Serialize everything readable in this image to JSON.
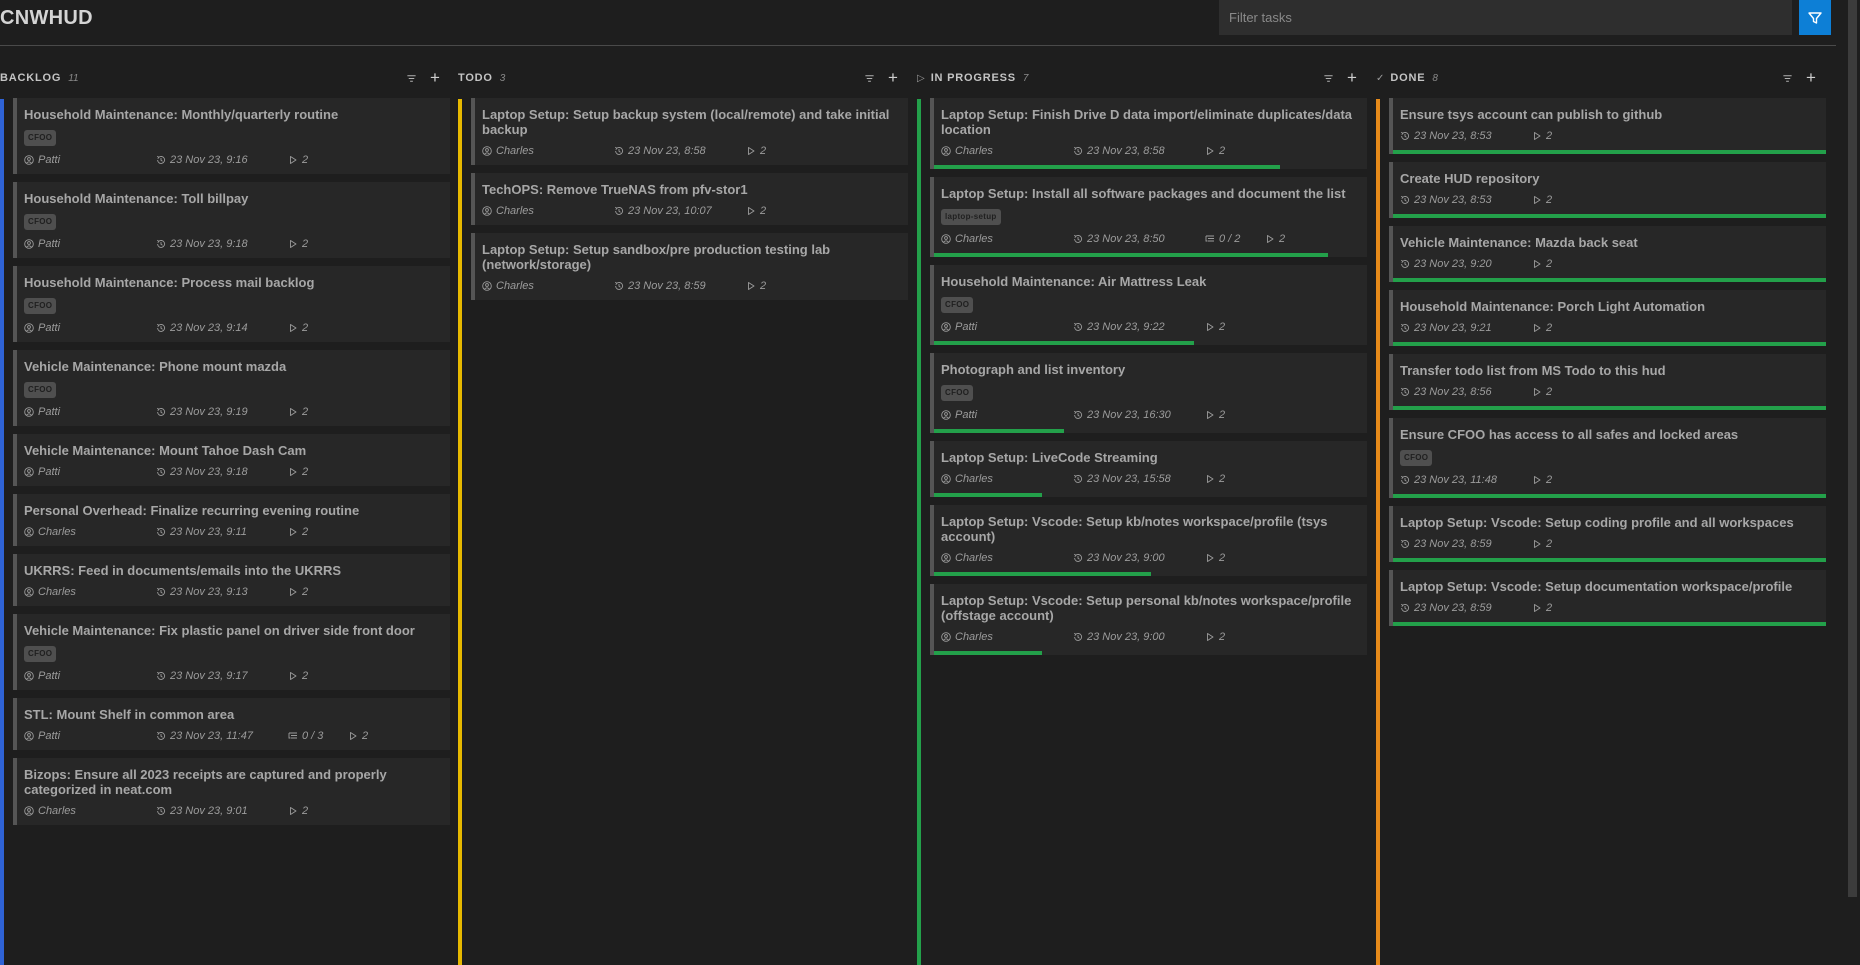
{
  "app": {
    "title": "CNWHUD"
  },
  "filter": {
    "placeholder": "Filter tasks",
    "button_icon": "filter-icon"
  },
  "colors": {
    "backlog": "#2f63d6",
    "todo": "#e6b800",
    "in_progress": "#23a04a",
    "done": "#e68a1a",
    "progress": "#23a04a",
    "accent": "#0d7fd6"
  },
  "columns": [
    {
      "name": "BACKLOG",
      "count": "11",
      "prefix": "",
      "cards": [
        {
          "title": "Household Maintenance: Monthly/quarterly routine",
          "tag": "CFOO",
          "owner": "Patti",
          "date": "23 Nov 23, 9:16",
          "points": "2"
        },
        {
          "title": "Household Maintenance: Toll billpay",
          "tag": "CFOO",
          "owner": "Patti",
          "date": "23 Nov 23, 9:18",
          "points": "2"
        },
        {
          "title": "Household Maintenance: Process mail backlog",
          "tag": "CFOO",
          "owner": "Patti",
          "date": "23 Nov 23, 9:14",
          "points": "2"
        },
        {
          "title": "Vehicle Maintenance: Phone mount mazda",
          "tag": "CFOO",
          "owner": "Patti",
          "date": "23 Nov 23, 9:19",
          "points": "2"
        },
        {
          "title": "Vehicle Maintenance: Mount Tahoe Dash Cam",
          "owner": "Patti",
          "date": "23 Nov 23, 9:18",
          "points": "2"
        },
        {
          "title": "Personal Overhead: Finalize recurring evening routine",
          "owner": "Charles",
          "date": "23 Nov 23, 9:11",
          "points": "2"
        },
        {
          "title": "UKRRS: Feed in documents/emails into the UKRRS",
          "owner": "Charles",
          "date": "23 Nov 23, 9:13",
          "points": "2"
        },
        {
          "title": "Vehicle Maintenance: Fix plastic panel on driver side front door",
          "tag": "CFOO",
          "owner": "Patti",
          "date": "23 Nov 23, 9:17",
          "points": "2"
        },
        {
          "title": "STL: Mount Shelf in common area",
          "owner": "Patti",
          "date": "23 Nov 23, 11:47",
          "subtasks": "0 / 3",
          "points": "2"
        },
        {
          "title": "Bizops: Ensure all 2023 receipts are captured and properly categorized in neat.com",
          "owner": "Charles",
          "date": "23 Nov 23, 9:01",
          "points": "2"
        }
      ]
    },
    {
      "name": "TODO",
      "count": "3",
      "prefix": "",
      "cards": [
        {
          "title": "Laptop Setup: Setup backup system (local/remote) and take initial backup",
          "owner": "Charles",
          "date": "23 Nov 23, 8:58",
          "points": "2"
        },
        {
          "title": "TechOPS: Remove TrueNAS from pfv-stor1",
          "owner": "Charles",
          "date": "23 Nov 23, 10:07",
          "points": "2"
        },
        {
          "title": "Laptop Setup: Setup sandbox/pre production testing lab (network/storage)",
          "owner": "Charles",
          "date": "23 Nov 23, 8:59",
          "points": "2"
        }
      ]
    },
    {
      "name": "IN PROGRESS",
      "count": "7",
      "prefix": "▷",
      "cards": [
        {
          "title": "Laptop Setup: Finish Drive D data import/eliminate duplicates/data location",
          "owner": "Charles",
          "date": "23 Nov 23, 8:58",
          "points": "2",
          "progress": 0.8
        },
        {
          "title": "Laptop Setup: Install all software packages and document the list",
          "tag": "laptop-setup",
          "owner": "Charles",
          "date": "23 Nov 23, 8:50",
          "subtasks": "0 / 2",
          "points": "2",
          "progress": 0.91
        },
        {
          "title": "Household Maintenance: Air Mattress Leak",
          "tag": "CFOO",
          "owner": "Patti",
          "date": "23 Nov 23, 9:22",
          "points": "2",
          "progress": 0.6
        },
        {
          "title": "Photograph and list inventory",
          "tag": "CFOO",
          "owner": "Patti",
          "date": "23 Nov 23, 16:30",
          "points": "2",
          "progress": 0.3
        },
        {
          "title": "Laptop Setup: LiveCode Streaming",
          "owner": "Charles",
          "date": "23 Nov 23, 15:58",
          "points": "2",
          "progress": 0.25
        },
        {
          "title": "Laptop Setup: Vscode: Setup kb/notes workspace/profile (tsys account)",
          "owner": "Charles",
          "date": "23 Nov 23, 9:00",
          "points": "2",
          "progress": 0.5
        },
        {
          "title": "Laptop Setup: Vscode: Setup personal kb/notes workspace/profile (offstage account)",
          "owner": "Charles",
          "date": "23 Nov 23, 9:00",
          "points": "2",
          "progress": 0.25
        }
      ]
    },
    {
      "name": "DONE",
      "count": "8",
      "prefix": "✓",
      "cards": [
        {
          "title": "Ensure tsys account can publish to github",
          "date": "23 Nov 23, 8:53",
          "points": "2",
          "progress": 1
        },
        {
          "title": "Create HUD repository",
          "date": "23 Nov 23, 8:53",
          "points": "2",
          "progress": 1
        },
        {
          "title": "Vehicle Maintenance: Mazda back seat",
          "date": "23 Nov 23, 9:20",
          "points": "2",
          "progress": 1
        },
        {
          "title": "Household Maintenance: Porch Light Automation",
          "date": "23 Nov 23, 9:21",
          "points": "2",
          "progress": 1
        },
        {
          "title": "Transfer todo list from MS Todo to this hud",
          "date": "23 Nov 23, 8:56",
          "points": "2",
          "progress": 1
        },
        {
          "title": "Ensure CFOO has access to all safes and locked areas",
          "tag": "CFOO",
          "date": "23 Nov 23, 11:48",
          "points": "2",
          "progress": 1
        },
        {
          "title": "Laptop Setup: Vscode: Setup coding profile and all workspaces",
          "date": "23 Nov 23, 8:59",
          "points": "2",
          "progress": 1
        },
        {
          "title": "Laptop Setup: Vscode: Setup documentation workspace/profile",
          "date": "23 Nov 23, 8:59",
          "points": "2",
          "progress": 1
        }
      ]
    }
  ]
}
